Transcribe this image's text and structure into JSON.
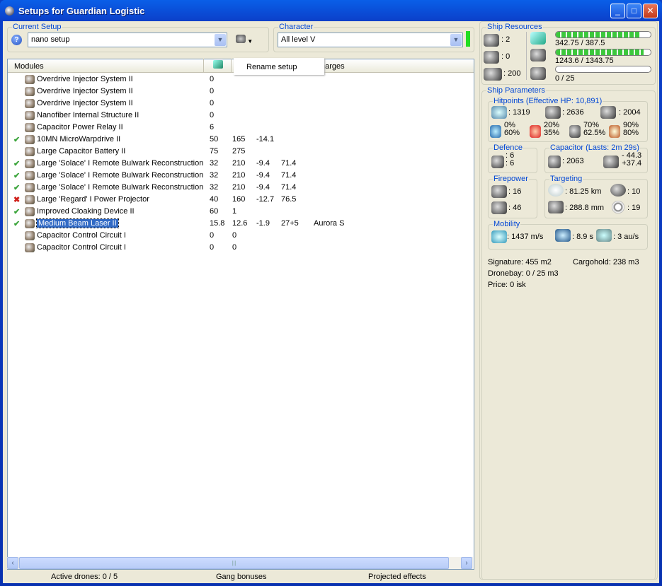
{
  "window": {
    "title": "Setups for Guardian Logistic",
    "buttons": [
      "minimize",
      "maximize",
      "close"
    ]
  },
  "current_setup": {
    "label": "Current Setup",
    "value": "nano setup",
    "help_icon": "question-icon"
  },
  "character": {
    "label": "Character",
    "value": "All level V",
    "indicator_color": "#22dd22"
  },
  "context_menu": {
    "item": "Rename setup"
  },
  "modules": {
    "headers": {
      "name": "Modules",
      "charges": "harges"
    },
    "rows": [
      {
        "state": "",
        "name": "Overdrive Injector System II",
        "c1": "0",
        "c2": "",
        "c3": "",
        "c4": "",
        "charge": ""
      },
      {
        "state": "",
        "name": "Overdrive Injector System II",
        "c1": "0",
        "c2": "",
        "c3": "",
        "c4": "",
        "charge": ""
      },
      {
        "state": "",
        "name": "Overdrive Injector System II",
        "c1": "0",
        "c2": "",
        "c3": "",
        "c4": "",
        "charge": ""
      },
      {
        "state": "",
        "name": "Nanofiber Internal Structure II",
        "c1": "0",
        "c2": "",
        "c3": "",
        "c4": "",
        "charge": ""
      },
      {
        "state": "",
        "name": "Capacitor Power Relay II",
        "c1": "6",
        "c2": "",
        "c3": "",
        "c4": "",
        "charge": ""
      },
      {
        "state": "active",
        "name": "10MN MicroWarpdrive II",
        "c1": "50",
        "c2": "165",
        "c3": "-14.1",
        "c4": "",
        "charge": ""
      },
      {
        "state": "",
        "name": "Large Capacitor Battery II",
        "c1": "75",
        "c2": "275",
        "c3": "",
        "c4": "",
        "charge": ""
      },
      {
        "state": "active",
        "name": "Large 'Solace' I Remote Bulwark Reconstruction",
        "c1": "32",
        "c2": "210",
        "c3": "-9.4",
        "c4": "71.4",
        "charge": ""
      },
      {
        "state": "active",
        "name": "Large 'Solace' I Remote Bulwark Reconstruction",
        "c1": "32",
        "c2": "210",
        "c3": "-9.4",
        "c4": "71.4",
        "charge": ""
      },
      {
        "state": "active",
        "name": "Large 'Solace' I Remote Bulwark Reconstruction",
        "c1": "32",
        "c2": "210",
        "c3": "-9.4",
        "c4": "71.4",
        "charge": ""
      },
      {
        "state": "offline",
        "name": "Large 'Regard' I Power Projector",
        "c1": "40",
        "c2": "160",
        "c3": "-12.7",
        "c4": "76.5",
        "charge": ""
      },
      {
        "state": "active",
        "name": "Improved Cloaking Device II",
        "c1": "60",
        "c2": "1",
        "c3": "",
        "c4": "",
        "charge": ""
      },
      {
        "state": "active",
        "name": "Medium Beam Laser II",
        "c1": "15.8",
        "c2": "12.6",
        "c3": "-1.9",
        "c4": "27+5",
        "charge": "Aurora S",
        "selected": true
      },
      {
        "state": "",
        "name": "Capacitor Control Circuit I",
        "c1": "0",
        "c2": "0",
        "c3": "",
        "c4": "",
        "charge": ""
      },
      {
        "state": "",
        "name": "Capacitor Control Circuit I",
        "c1": "0",
        "c2": "0",
        "c3": "",
        "c4": "",
        "charge": ""
      }
    ]
  },
  "status_bar": {
    "drones": "Active drones: 0 / 5",
    "gang": "Gang bonuses",
    "projected": "Projected effects"
  },
  "resources": {
    "label": "Ship Resources",
    "turrets": ": 2",
    "launchers": ": 0",
    "calibration": ": 200",
    "cpu": "342.75 / 387.5",
    "cpu_fraction": 0.885,
    "power": "1243.6 / 1343.75",
    "power_fraction": 0.925,
    "drone_bw": "0 / 25",
    "drone_fraction": 0
  },
  "parameters": {
    "label": "Ship Parameters",
    "hitpoints": {
      "label": "Hitpoints (Effective HP: 10,891)",
      "shield": ": 1319",
      "armor": ": 2636",
      "structure": ": 2004",
      "em": [
        "0%",
        "60%"
      ],
      "thermal": [
        "20%",
        "35%"
      ],
      "kinetic": [
        "70%",
        "62.5%"
      ],
      "explosive": [
        "90%",
        "80%"
      ]
    },
    "defence": {
      "label": "Defence",
      "a": ": 6",
      "b": ": 6"
    },
    "capacitor": {
      "label": "Capacitor (Lasts: 2m 29s)",
      "capacity": ": 2063",
      "use": "- 44.3",
      "recharge": "+37.4"
    },
    "firepower": {
      "label": "Firepower",
      "a": ": 16",
      "b": ": 46"
    },
    "targeting": {
      "label": "Targeting",
      "range": ": 81.25 km",
      "targets": ": 10",
      "resolution": ": 288.8 mm",
      "sensor": ": 19"
    },
    "mobility": {
      "label": "Mobility",
      "speed": ": 1437 m/s",
      "align": ": 8.9 s",
      "warp": ": 3 au/s"
    },
    "signature": "Signature: 455 m2",
    "cargohold": "Cargohold: 238 m3",
    "dronebay": "Dronebay: 0 / 25 m3",
    "price": "Price: 0 isk"
  }
}
